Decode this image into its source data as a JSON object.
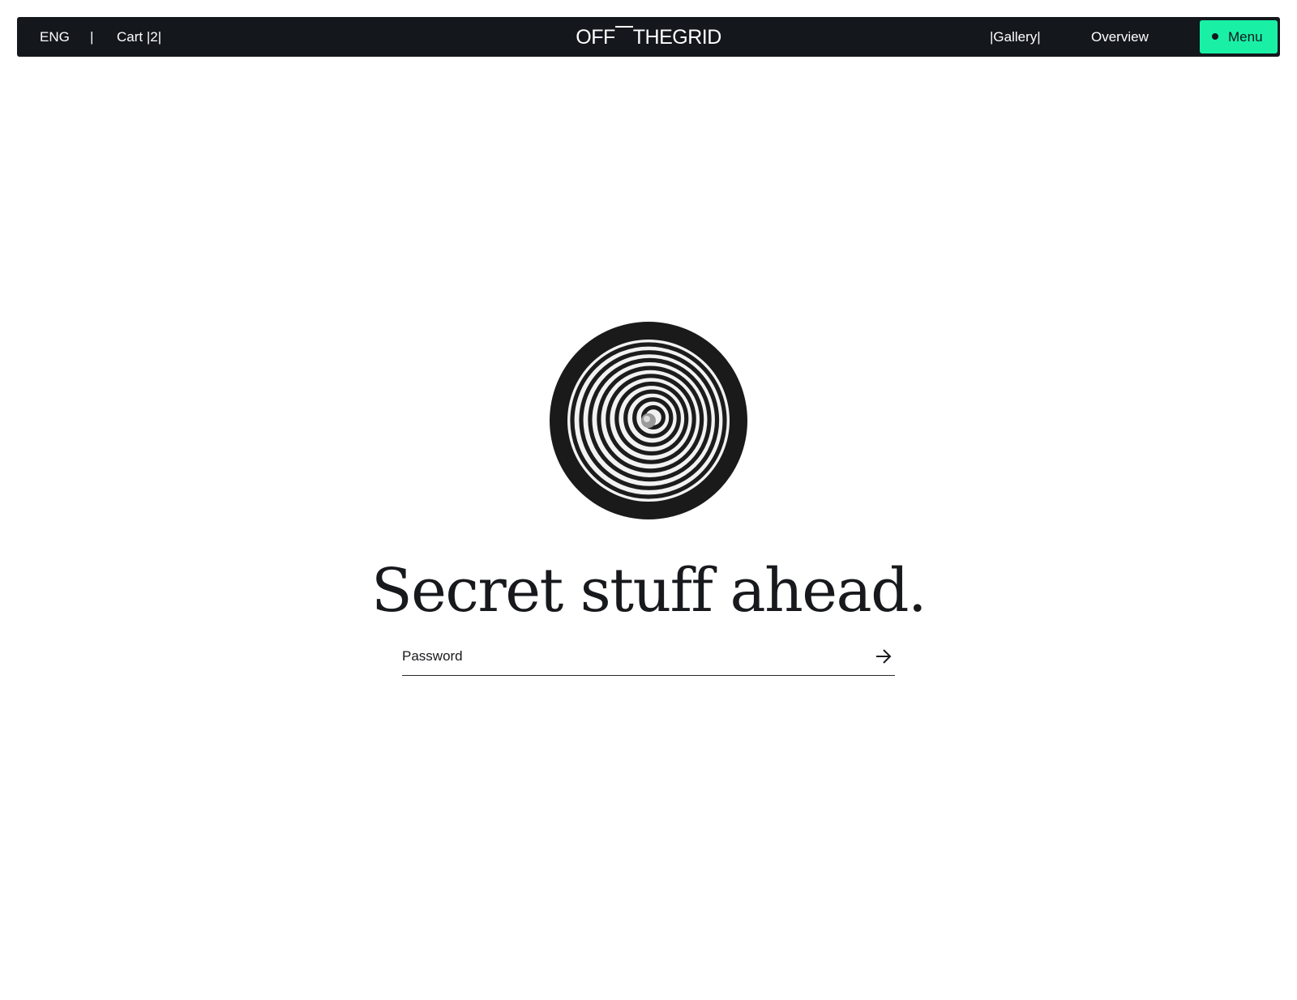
{
  "topbar": {
    "language": "ENG",
    "separator": "|",
    "cart_label": "Cart |2|",
    "logo_left": "OFF",
    "logo_right": "THEGRID",
    "nav_gallery": "|Gallery|",
    "nav_overview": "Overview",
    "menu_label": "Menu"
  },
  "main": {
    "headline": "Secret stuff ahead.",
    "password": {
      "placeholder": "Password",
      "value": ""
    },
    "submit_icon": "arrow-right-icon",
    "hero_icon": "spiral-disc-icon"
  },
  "colors": {
    "topbar_bg": "#14181d",
    "accent": "#19f0a6",
    "text_dark": "#17191c",
    "background": "#ffffff"
  }
}
